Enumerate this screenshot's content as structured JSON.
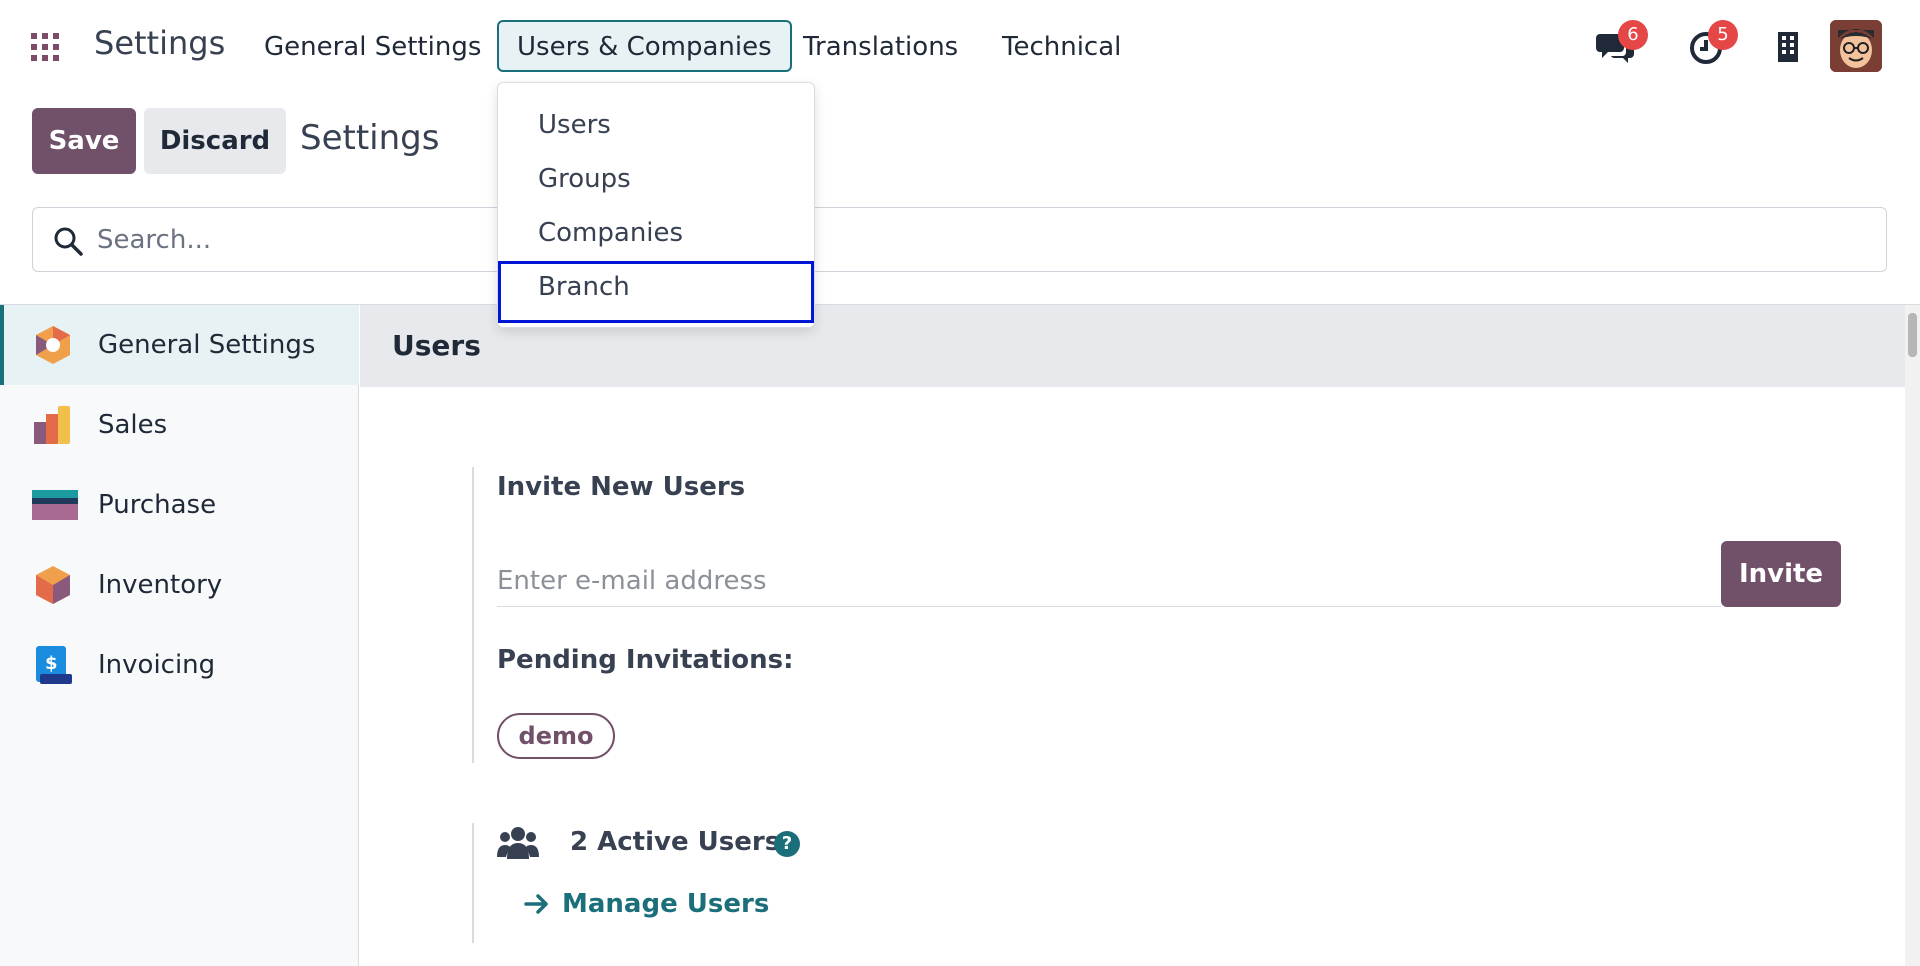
{
  "navbar": {
    "brand": "Settings",
    "menu": [
      {
        "label": "General Settings"
      },
      {
        "label": "Users & Companies"
      },
      {
        "label": "Translations"
      },
      {
        "label": "Technical"
      }
    ],
    "messages_badge": "6",
    "activity_badge": "5"
  },
  "dropdown": {
    "items": [
      {
        "label": "Users"
      },
      {
        "label": "Groups"
      },
      {
        "label": "Companies"
      },
      {
        "label": "Branch"
      }
    ]
  },
  "control_panel": {
    "save_label": "Save",
    "discard_label": "Discard",
    "title": "Settings"
  },
  "search": {
    "placeholder": "Search..."
  },
  "sidebar": {
    "items": [
      {
        "label": "General Settings"
      },
      {
        "label": "Sales"
      },
      {
        "label": "Purchase"
      },
      {
        "label": "Inventory"
      },
      {
        "label": "Invoicing"
      }
    ]
  },
  "main": {
    "section_title": "Users",
    "invite_title": "Invite New Users",
    "email_placeholder": "Enter e-mail address",
    "invite_label": "Invite",
    "pending_label": "Pending Invitations:",
    "pending_users": [
      "demo"
    ],
    "active_users_label": "2 Active Users",
    "help_label": "?",
    "manage_users_label": "Manage Users"
  },
  "colors": {
    "primary": "#71506a",
    "accent": "#1b6f7b",
    "badge": "#e54646",
    "highlight_border": "#0015d6"
  }
}
